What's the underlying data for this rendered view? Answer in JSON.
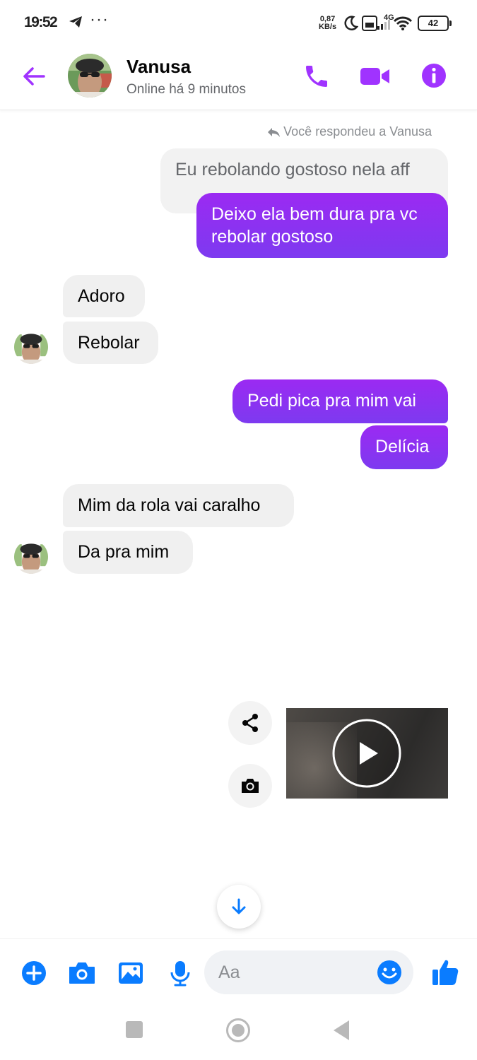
{
  "status_bar": {
    "time": "19:52",
    "network_speed_value": "0,87",
    "network_speed_unit": "KB/s",
    "network_type": "4G",
    "battery": "42"
  },
  "header": {
    "contact_name": "Vanusa",
    "contact_status": "Online há 9 minutos"
  },
  "messages": {
    "reply_label": "Você respondeu a Vanusa",
    "quoted": "Eu rebolando gostoso nela aff",
    "m1_out": "Deixo ela bem dura pra vc rebolar gostoso",
    "m2_in": "Adoro",
    "m3_in": "Rebolar",
    "m4_out": "Pedi pica pra mim vai",
    "m5_out": "Delícia",
    "m6_in": "Mim da rola vai caralho",
    "m7_in": "Da pra mim"
  },
  "composer": {
    "placeholder": "Aa"
  },
  "colors": {
    "accent_purple": "#a033ff",
    "bubble_out": "#8a2be2",
    "messenger_blue": "#0a7cff",
    "bubble_in": "#f0f0f0"
  }
}
